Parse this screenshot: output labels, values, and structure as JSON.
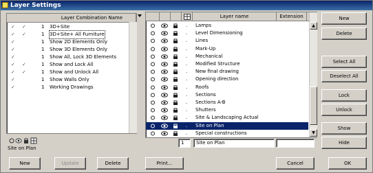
{
  "window": {
    "title": "Layer Settings"
  },
  "left": {
    "header": "Layer Combination Name",
    "rows": [
      {
        "num": "1",
        "name": "3D+Site",
        "selected": false
      },
      {
        "num": "1",
        "name": "3D+Site+ All Furniture",
        "selected": true
      },
      {
        "num": "1",
        "name": "Show 2D Elements Only",
        "selected": false
      },
      {
        "num": "1",
        "name": "Show 3D Elements Only",
        "selected": false
      },
      {
        "num": "1",
        "name": "Show All, Lock 3D Elements",
        "selected": false
      },
      {
        "num": "1",
        "name": "Show and Lock All",
        "selected": false
      },
      {
        "num": "1",
        "name": "Show and Unlock All",
        "selected": false
      },
      {
        "num": "1",
        "name": "Show Walls Only",
        "selected": false
      },
      {
        "num": "1",
        "name": "Working Drawings",
        "selected": false
      }
    ],
    "current_name": "Site on Plan",
    "new_label": "New",
    "update_label": "Update",
    "delete_label": "Delete"
  },
  "right": {
    "header_name": "Layer name",
    "header_ext": "Extension",
    "rows": [
      {
        "name": "Lamps",
        "selected": false
      },
      {
        "name": "Level Dimensioning",
        "selected": false
      },
      {
        "name": "Lines",
        "selected": false
      },
      {
        "name": "Mark-Up",
        "selected": false
      },
      {
        "name": "Mechanical",
        "selected": false
      },
      {
        "name": "Modified Structure",
        "selected": false
      },
      {
        "name": "New final drawing",
        "selected": false
      },
      {
        "name": "Opening direction",
        "selected": false
      },
      {
        "name": "Roofs",
        "selected": false
      },
      {
        "name": "Sections",
        "selected": false
      },
      {
        "name": "Sections A-B",
        "selected": false
      },
      {
        "name": "Shutters",
        "selected": false
      },
      {
        "name": "Site & Landscaping Actual",
        "selected": false
      },
      {
        "name": "Site on Plan",
        "selected": true
      },
      {
        "name": "Special constructions",
        "selected": false
      }
    ],
    "edit_num": "1",
    "edit_name": "Site on Plan",
    "edit_ext": ""
  },
  "buttons": {
    "new": "New",
    "delete": "Delete",
    "select_all": "Select All",
    "deselect_all": "Deselect All",
    "lock": "Lock",
    "unlock": "Unlock",
    "show": "Show",
    "hide": "Hide",
    "print": "Print...",
    "cancel": "Cancel",
    "ok": "OK"
  },
  "colors": {
    "selection": "#0a246a",
    "dialog_bg": "#d4d0c8"
  }
}
